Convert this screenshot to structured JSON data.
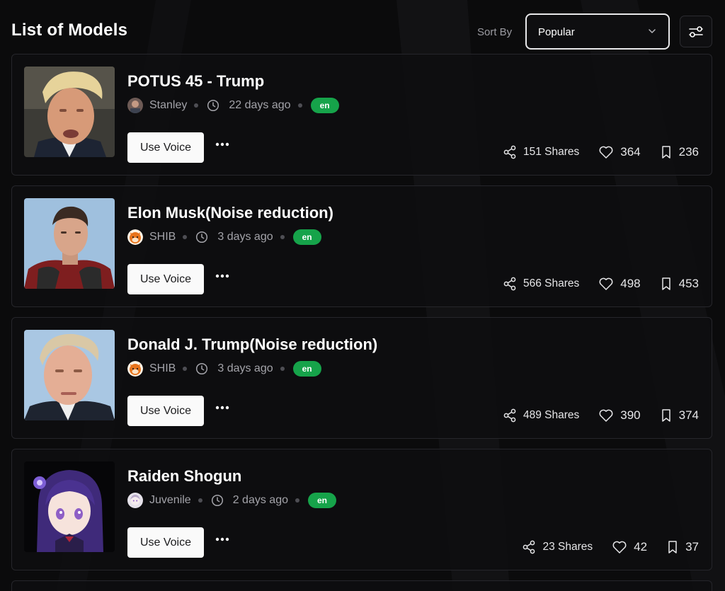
{
  "header": {
    "title": "List of Models",
    "sort_label": "Sort By",
    "sort_value": "Popular"
  },
  "cards": [
    {
      "name": "POTUS 45 - Trump",
      "author": "Stanley",
      "time": "22 days ago",
      "lang": "en",
      "use_label": "Use Voice",
      "shares": "151 Shares",
      "likes": "364",
      "saves": "236"
    },
    {
      "name": "Elon Musk(Noise reduction)",
      "author": "SHIB",
      "time": "3 days ago",
      "lang": "en",
      "use_label": "Use Voice",
      "shares": "566 Shares",
      "likes": "498",
      "saves": "453"
    },
    {
      "name": "Donald J. Trump(Noise reduction)",
      "author": "SHIB",
      "time": "3 days ago",
      "lang": "en",
      "use_label": "Use Voice",
      "shares": "489 Shares",
      "likes": "390",
      "saves": "374"
    },
    {
      "name": "Raiden Shogun",
      "author": "Juvenile",
      "time": "2 days ago",
      "lang": "en",
      "use_label": "Use Voice",
      "shares": "23 Shares",
      "likes": "42",
      "saves": "37"
    }
  ],
  "colors": {
    "background": "#0b0b0c",
    "card_border": "#26262b",
    "lang_badge": "#16a34a",
    "button_bg": "#fafafa"
  },
  "icons": [
    "chevron-down-icon",
    "filter-sliders-icon",
    "clock-icon",
    "more-dots-icon",
    "share-icon",
    "heart-icon",
    "bookmark-icon"
  ]
}
